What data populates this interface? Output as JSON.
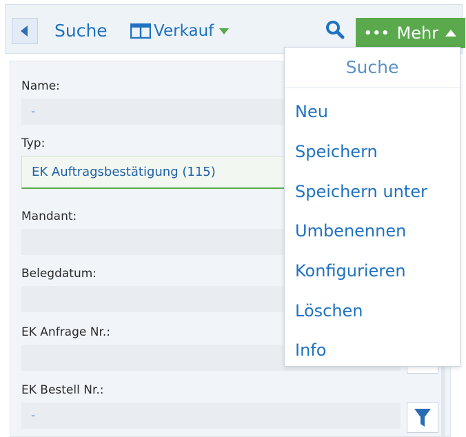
{
  "header": {
    "title": "Suche",
    "view_label": "Verkauf",
    "more_label": "Mehr",
    "icons": {
      "back": "caret-left-icon",
      "view": "columns-icon",
      "search": "search-icon",
      "more": "ellipsis-icon"
    }
  },
  "fields": [
    {
      "label": "Name:",
      "value": "-"
    },
    {
      "label": "Typ:",
      "value": "EK Auftragsbestätigung (115)"
    },
    {
      "label": "Mandant:",
      "value": ""
    },
    {
      "label": "Belegdatum:",
      "value": ""
    },
    {
      "label": "EK Anfrage Nr.:",
      "value": ""
    },
    {
      "label": "EK Bestell Nr.:",
      "value": "-"
    }
  ],
  "menu": {
    "title": "Suche",
    "items": [
      "Neu",
      "Speichern",
      "Speichern unter",
      "Umbenennen",
      "Konfigurieren",
      "Löschen",
      "Info"
    ]
  },
  "colors": {
    "accent": "#1f72c1",
    "green": "#5aa94d"
  }
}
